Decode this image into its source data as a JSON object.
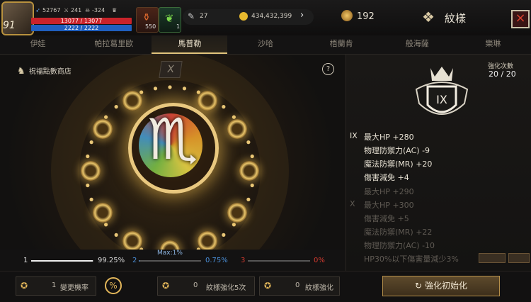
{
  "player": {
    "level": "91",
    "stat_a": "52767",
    "stat_b": "241",
    "stat_c": "-324",
    "hp": "13077 / 13077",
    "mp": "2222 / 2222"
  },
  "items": {
    "potion_count": "550",
    "herb_count": "1"
  },
  "currency": {
    "feather": "27",
    "gold": "434,432,399",
    "medal": "192"
  },
  "header": {
    "title": "紋樣"
  },
  "tabs": [
    {
      "label": "伊娃"
    },
    {
      "label": "帕拉葛里歐"
    },
    {
      "label": "馬普勒"
    },
    {
      "label": "沙哈"
    },
    {
      "label": "梧蘭肯"
    },
    {
      "label": "般海薩"
    },
    {
      "label": "樂琳"
    }
  ],
  "shop": {
    "label": "祝福點數商店"
  },
  "emblem": {
    "center_roman": "X"
  },
  "enhance": {
    "count_label": "強化次數",
    "count_value": "20 / 20",
    "rank": "IX"
  },
  "stats_active": [
    {
      "tier": "IX",
      "text": "最大HP +280"
    },
    {
      "tier": "",
      "text": "物理防禦力(AC) -9"
    },
    {
      "tier": "",
      "text": "魔法防禦(MR) +20"
    },
    {
      "tier": "",
      "text": "傷害減免 +4"
    }
  ],
  "stats_dim": [
    {
      "tier": "",
      "text": "最大HP +290"
    },
    {
      "tier": "X",
      "text": "最大HP +300"
    },
    {
      "tier": "",
      "text": "傷害減免 +5"
    },
    {
      "tier": "",
      "text": "魔法防禦(MR) +22"
    },
    {
      "tier": "",
      "text": "物理防禦力(AC) -10"
    },
    {
      "tier": "",
      "text": "HP30%以下傷害量減少3%"
    }
  ],
  "progress": {
    "max_label": "Max:1%",
    "slot1": {
      "num": "1",
      "pct": "99.25%",
      "fill": 0.9925
    },
    "slot2": {
      "num": "2",
      "pct": "0.75%",
      "fill": 0.0075
    },
    "slot3": {
      "num": "3",
      "pct": "0%",
      "fill": 0
    }
  },
  "bottom": {
    "change_count": "1",
    "change_label": "變更機率",
    "enh5_count": "0",
    "enh5_label": "紋樣強化5次",
    "enh_count": "0",
    "enh_label": "紋樣強化",
    "reset_label": "強化初始化"
  },
  "colors": {
    "accent_gold": "#e1c47d",
    "hp_red": "#c9232a",
    "mp_blue": "#1f5fbf",
    "slot2_blue": "#4a8fd8",
    "slot3_red": "#d23a2f"
  }
}
